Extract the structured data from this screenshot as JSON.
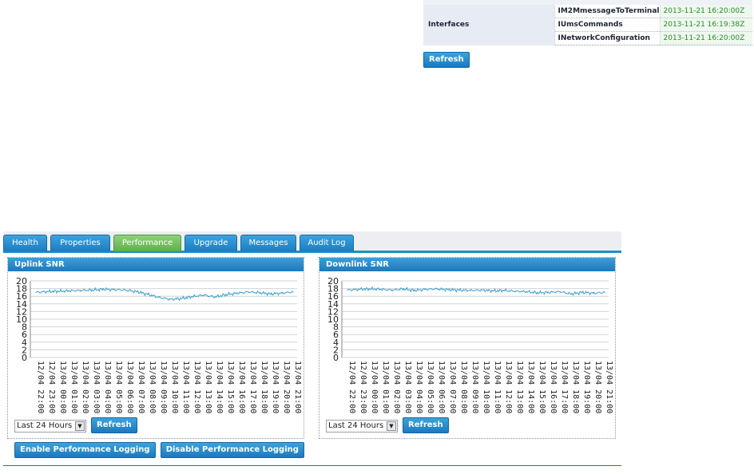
{
  "interfaces": {
    "label": "Interfaces",
    "items": [
      {
        "name": "IM2MmessageToTerminal",
        "timestamp": "2013-11-21 16:20:00Z"
      },
      {
        "name": "IUmsCommands",
        "timestamp": "2013-11-21 16:19:38Z"
      },
      {
        "name": "INetworkConfiguration",
        "timestamp": "2013-11-21 16:20:00Z"
      }
    ],
    "refresh_label": "Refresh"
  },
  "tabs": [
    {
      "label": "Health",
      "active": false
    },
    {
      "label": "Properties",
      "active": false
    },
    {
      "label": "Performance",
      "active": true
    },
    {
      "label": "Upgrade",
      "active": false
    },
    {
      "label": "Messages",
      "active": false
    },
    {
      "label": "Audit Log",
      "active": false
    }
  ],
  "charts": [
    {
      "title": "Uplink SNR",
      "range_value": "Last 24 Hours",
      "refresh_label": "Refresh"
    },
    {
      "title": "Downlink SNR",
      "range_value": "Last 24 Hours",
      "refresh_label": "Refresh"
    }
  ],
  "perf_actions": {
    "enable_label": "Enable Performance Logging",
    "disable_label": "Disable Performance Logging"
  },
  "colors": {
    "accent": "#1f8ec8",
    "active_tab": "#6bb654",
    "series_line": "#3aa0cc",
    "timestamp": "#2a8a2a"
  },
  "chart_data": [
    {
      "type": "line",
      "title": "Uplink SNR",
      "yticks": [
        0,
        2,
        4,
        6,
        8,
        10,
        12,
        14,
        16,
        18,
        20
      ],
      "ylim": [
        0,
        20
      ],
      "categories": [
        "12/04 22:00",
        "12/04 23:00",
        "13/04 00:00",
        "13/04 01:00",
        "13/04 02:00",
        "13/04 03:00",
        "13/04 04:00",
        "13/04 05:00",
        "13/04 06:00",
        "13/04 07:00",
        "13/04 08:00",
        "13/04 09:00",
        "13/04 10:00",
        "13/04 11:00",
        "13/04 12:00",
        "13/04 13:00",
        "13/04 14:00",
        "13/04 15:00",
        "13/04 16:00",
        "13/04 17:00",
        "13/04 18:00",
        "13/04 19:00",
        "13/04 20:00",
        "13/04 21:00"
      ],
      "series": [
        {
          "values": [
            17.0,
            17.2,
            17.3,
            17.4,
            17.5,
            17.6,
            17.8,
            17.7,
            17.6,
            17.2,
            16.5,
            15.7,
            15.2,
            15.4,
            15.9,
            16.3,
            15.8,
            16.4,
            16.8,
            17.1,
            16.9,
            16.6,
            16.8,
            17.1
          ]
        }
      ]
    },
    {
      "type": "line",
      "title": "Downlink SNR",
      "yticks": [
        0,
        2,
        4,
        6,
        8,
        10,
        12,
        14,
        16,
        18,
        20
      ],
      "ylim": [
        0,
        20
      ],
      "categories": [
        "12/04 22:00",
        "12/04 23:00",
        "13/04 00:00",
        "13/04 01:00",
        "13/04 02:00",
        "13/04 03:00",
        "13/04 04:00",
        "13/04 05:00",
        "13/04 06:00",
        "13/04 07:00",
        "13/04 08:00",
        "13/04 09:00",
        "13/04 10:00",
        "13/04 11:00",
        "13/04 12:00",
        "13/04 13:00",
        "13/04 14:00",
        "13/04 15:00",
        "13/04 16:00",
        "13/04 17:00",
        "13/04 18:00",
        "13/04 19:00",
        "13/04 20:00",
        "13/04 21:00"
      ],
      "series": [
        {
          "values": [
            17.6,
            17.8,
            17.9,
            17.8,
            17.6,
            17.9,
            17.5,
            17.8,
            17.9,
            17.7,
            17.6,
            17.5,
            17.6,
            17.4,
            17.5,
            17.3,
            17.2,
            16.9,
            17.0,
            17.2,
            16.6,
            17.0,
            16.8,
            17.0
          ]
        }
      ]
    }
  ]
}
